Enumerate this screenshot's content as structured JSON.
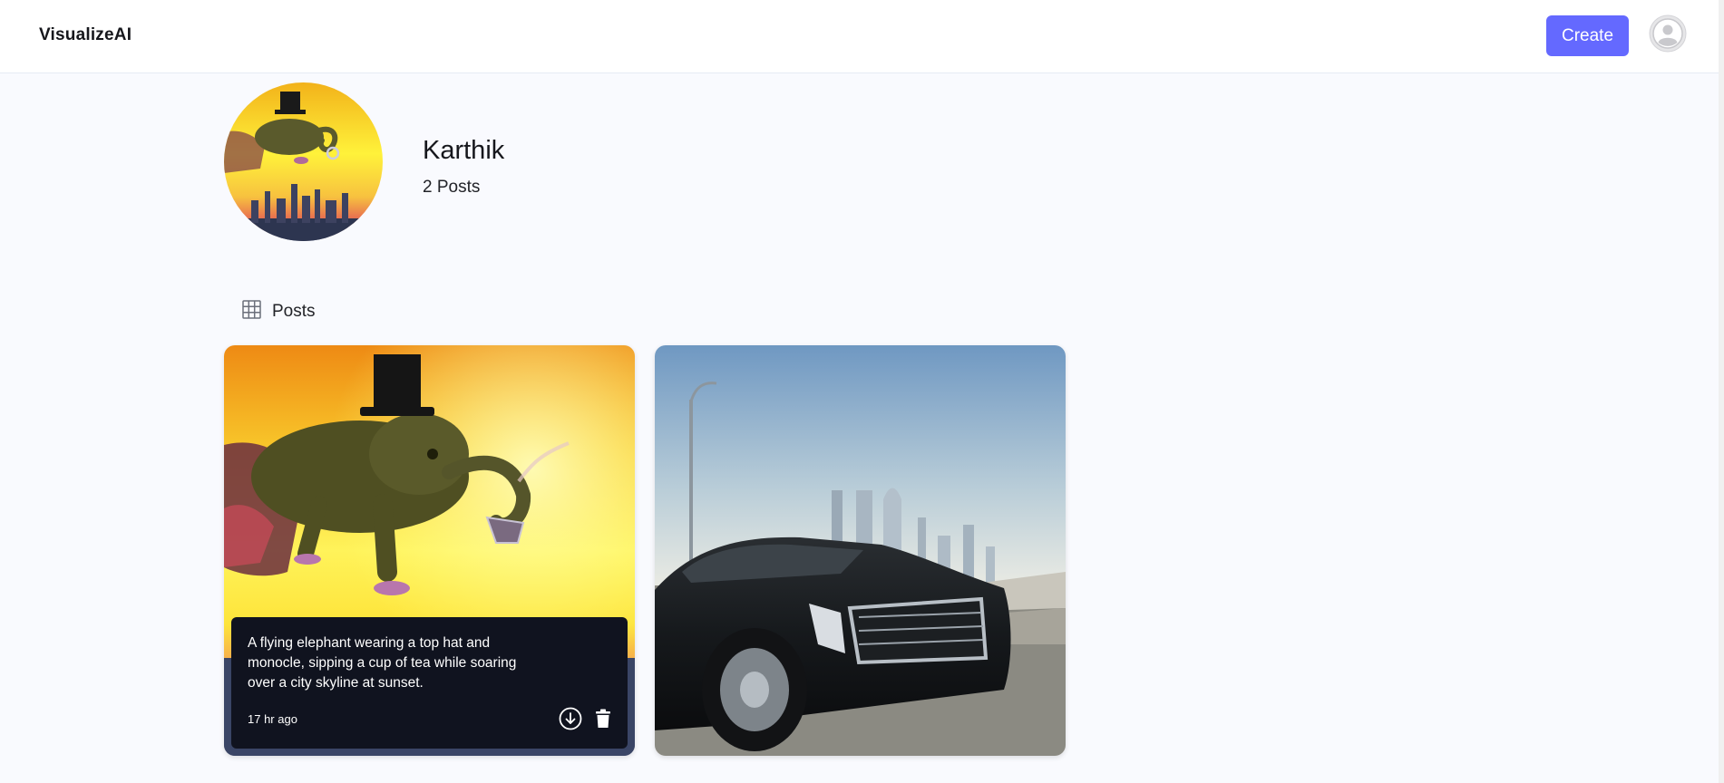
{
  "app": {
    "logo": "VisualizeAI"
  },
  "header": {
    "create_label": "Create",
    "avatar_icon": "user-avatar-icon"
  },
  "profile": {
    "name": "Karthik",
    "post_count": "2 Posts"
  },
  "tabs": {
    "posts_label": "Posts",
    "posts_icon": "grid-icon"
  },
  "posts": [
    {
      "prompt": "A flying elephant wearing a top hat and monocle, sipping a cup of tea while soaring over a city skyline at sunset.",
      "time": "17 hr ago",
      "download_icon": "download-icon",
      "delete_icon": "trash-icon"
    },
    {
      "subject": "car-on-highway-image"
    }
  ],
  "colors": {
    "accent": "#6469ff",
    "overlay": "#10131f",
    "background": "#f9fafe"
  }
}
